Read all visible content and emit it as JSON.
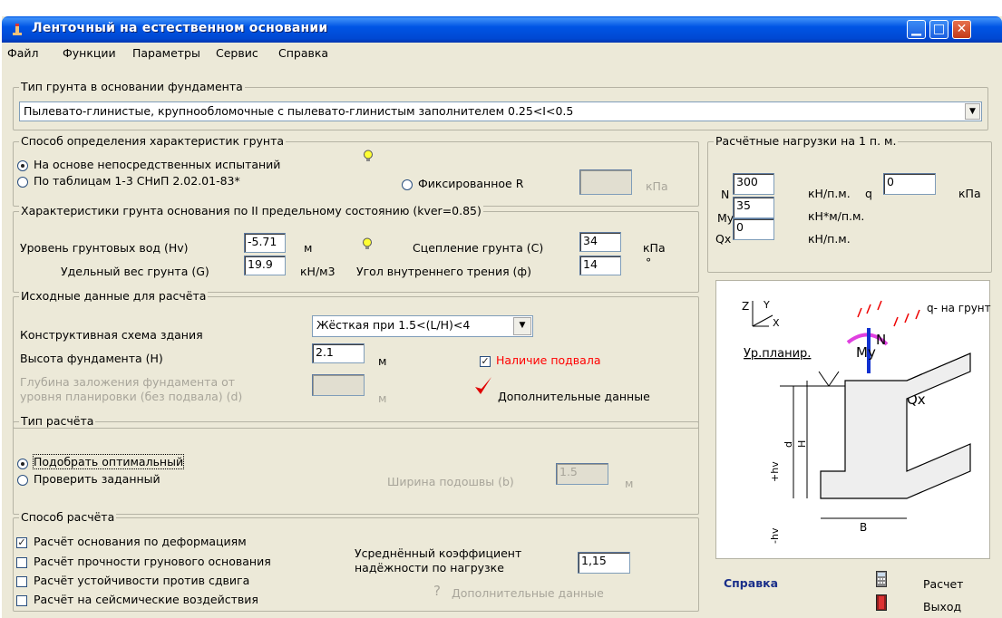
{
  "window": {
    "title": "Ленточный на естественном основании"
  },
  "menu": [
    "Файл",
    "Функции",
    "Параметры",
    "Сервис",
    "Справка"
  ],
  "soil_type": {
    "legend": "Тип грунта в основании фундамента",
    "selected": "Пылевато-глинистые, крупнообломочные с пылевато-глинистым заполнителем  0.25<I<0.5"
  },
  "method": {
    "legend": "Способ определения характеристик грунта",
    "opt1": "На основе непосредственных испытаний",
    "opt2": "По таблицам 1-3 СНиП 2.02.01-83*",
    "opt3": "Фиксированное R",
    "unit": "кПа"
  },
  "soil_chars": {
    "legend": "Характеристики грунта основания по II предельному состоянию (kver=0.85)",
    "hv_label": "Уровень грунтовых вод (Hv)",
    "hv_value": "-5.71",
    "hv_unit": "м",
    "g_label": "Удельный вес грунта (G)",
    "g_value": "19.9",
    "g_unit": "кН/м3",
    "c_label": "Сцепление грунта (C)",
    "c_value": "34",
    "c_unit": "кПа",
    "phi_label": "Угол внутреннего трения (ф)",
    "phi_value": "14",
    "phi_unit": "°"
  },
  "input_data": {
    "legend": "Исходные данные для расчёта",
    "scheme_label": "Конструктивная схема здания",
    "scheme_value": "Жёсткая при 1.5<(L/H)<4",
    "h_label": "Высота фундамента (H)",
    "h_value": "2.1",
    "h_unit": "м",
    "d_label1": "Глубина заложения фундамента от",
    "d_label2": "уровня планировки (без подвала) (d)",
    "d_unit": "м",
    "basement": "Наличие подвала",
    "extra": "Дополнительные данные"
  },
  "calc_type": {
    "legend": "Тип расчёта",
    "opt1": "Подобрать оптимальный",
    "opt2": "Проверить заданный",
    "b_label": "Ширина подошвы (b)",
    "b_value": "1.5",
    "b_unit": "м"
  },
  "calc_method": {
    "legend": "Способ расчёта",
    "c1": "Расчёт основания по деформациям",
    "c2": "Расчёт прочности грунового основания",
    "c3": "Расчёт устойчивости против сдвига",
    "c4": "Расчёт на сейсмические воздействия",
    "coef_label1": "Усреднённый коэффициент",
    "coef_label2": "надёжности по нагрузке",
    "coef_value": "1,15",
    "extra": "Дополнительные данные"
  },
  "loads": {
    "legend": "Расчётные нагрузки на 1 п. м.",
    "n_label": "N",
    "n_value": "300",
    "n_unit": "кН/п.м.",
    "q_label": "q",
    "q_value": "0",
    "q_unit": "кПа",
    "my_label": "My",
    "my_value": "35",
    "my_unit": "кН*м/п.м.",
    "qx_label": "Qx",
    "qx_value": "0",
    "qx_unit": "кН/п.м."
  },
  "diagram": {
    "q_label": "q- на грунт",
    "level_label": "Ур.планир.",
    "my": "My",
    "n": "N",
    "qx": "Qx",
    "z": "Z",
    "y": "Y",
    "x": "X",
    "h": "H",
    "d": "d",
    "hv_pos": "+hv",
    "hv_neg": "-hv",
    "b": "B"
  },
  "footer": {
    "help": "Справка",
    "calc": "Расчет",
    "exit": "Выход"
  },
  "colors": {
    "title_bar": "#0055e5",
    "basement_text": "#ff0000",
    "help_link": "#1a2f8a",
    "check_mark": "#e00000"
  }
}
